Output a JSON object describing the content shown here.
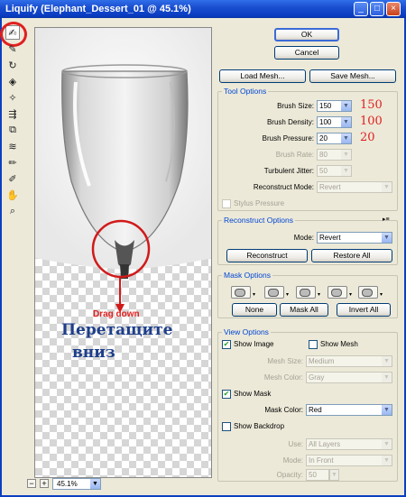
{
  "window": {
    "title": "Liquify (Elephant_Dessert_01 @ 45.1%)"
  },
  "annotations": {
    "drag_en": "Drag down",
    "drag_ru_1": "Перетащите",
    "drag_ru_2": "вниз",
    "brush_size_num": "150",
    "brush_density_num": "100",
    "brush_pressure_num": "20"
  },
  "buttons": {
    "ok": "OK",
    "cancel": "Cancel",
    "load_mesh": "Load Mesh...",
    "save_mesh": "Save Mesh...",
    "reconstruct": "Reconstruct",
    "restore_all": "Restore All",
    "none": "None",
    "mask_all": "Mask All",
    "invert_all": "Invert All"
  },
  "tool_options": {
    "title": "Tool Options",
    "brush_size": {
      "label": "Brush Size:",
      "value": "150"
    },
    "brush_density": {
      "label": "Brush Density:",
      "value": "100"
    },
    "brush_pressure": {
      "label": "Brush Pressure:",
      "value": "20"
    },
    "brush_rate": {
      "label": "Brush Rate:",
      "value": "80"
    },
    "turbulent_jitter": {
      "label": "Turbulent Jitter:",
      "value": "50"
    },
    "reconstruct_mode": {
      "label": "Reconstruct Mode:",
      "value": "Revert"
    },
    "stylus_pressure": "Stylus Pressure"
  },
  "reconstruct_options": {
    "title": "Reconstruct Options",
    "mode_label": "Mode:",
    "mode_value": "Revert"
  },
  "mask_options": {
    "title": "Mask Options"
  },
  "view_options": {
    "title": "View Options",
    "show_image": "Show Image",
    "show_mesh": "Show Mesh",
    "mesh_size": {
      "label": "Mesh Size:",
      "value": "Medium"
    },
    "mesh_color": {
      "label": "Mesh Color:",
      "value": "Gray"
    },
    "show_mask": "Show Mask",
    "mask_color": {
      "label": "Mask Color:",
      "value": "Red"
    },
    "show_backdrop": "Show Backdrop",
    "use": {
      "label": "Use:",
      "value": "All Layers"
    },
    "mode": {
      "label": "Mode:",
      "value": "In Front"
    },
    "opacity": {
      "label": "Opacity:",
      "value": "50"
    }
  },
  "zoom": {
    "value": "45.1%"
  },
  "colors": {
    "annotation_red": "#e02020",
    "annotation_blue": "#1d3e8a",
    "group_title_blue": "#0046d5"
  }
}
